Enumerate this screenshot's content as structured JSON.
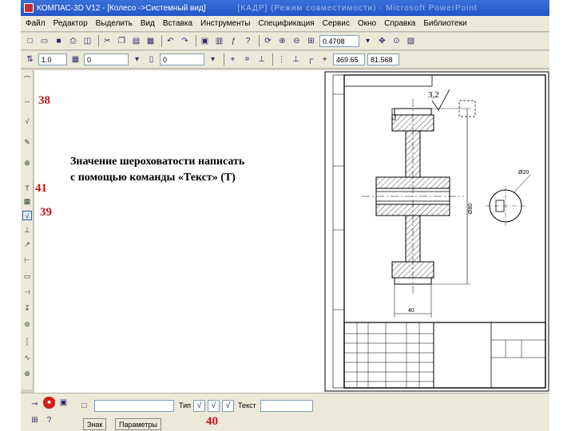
{
  "window": {
    "title": "КОМПАС-3D V12 - [Колесо ->Системный вид]",
    "title_blurred": "[КАДР] (Режим совместимости) - Microsoft PowerPoint"
  },
  "menu": [
    "Файл",
    "Редактор",
    "Выделить",
    "Вид",
    "Вставка",
    "Инструменты",
    "Спецификация",
    "Сервис",
    "Окно",
    "Справка",
    "Библиотеки"
  ],
  "toolbar1": {
    "zoom_value": "0.4708"
  },
  "toolbar2": {
    "style_value": "1.0",
    "layer_value": "0",
    "offset_value": "0",
    "coord_x": "469.65",
    "coord_y": "81.568"
  },
  "annotations": {
    "a38": "38",
    "a41": "41",
    "a39": "39",
    "a40": "40"
  },
  "note": {
    "line1": "Значение шероховатости написать",
    "line2": "с помощью команды «Текст» (Т)"
  },
  "drawing": {
    "roughness": "3,2",
    "dim_bore": "Ø20",
    "dim_vertical": "Ø80",
    "dim_width": "40"
  },
  "bottom_panel": {
    "type_label": "Тип",
    "text_label": "Текст",
    "tab_sign": "Знак",
    "tab_params": "Параметры"
  },
  "colors": {
    "annotation": "#d01010",
    "title_bar": "#2456c7"
  }
}
